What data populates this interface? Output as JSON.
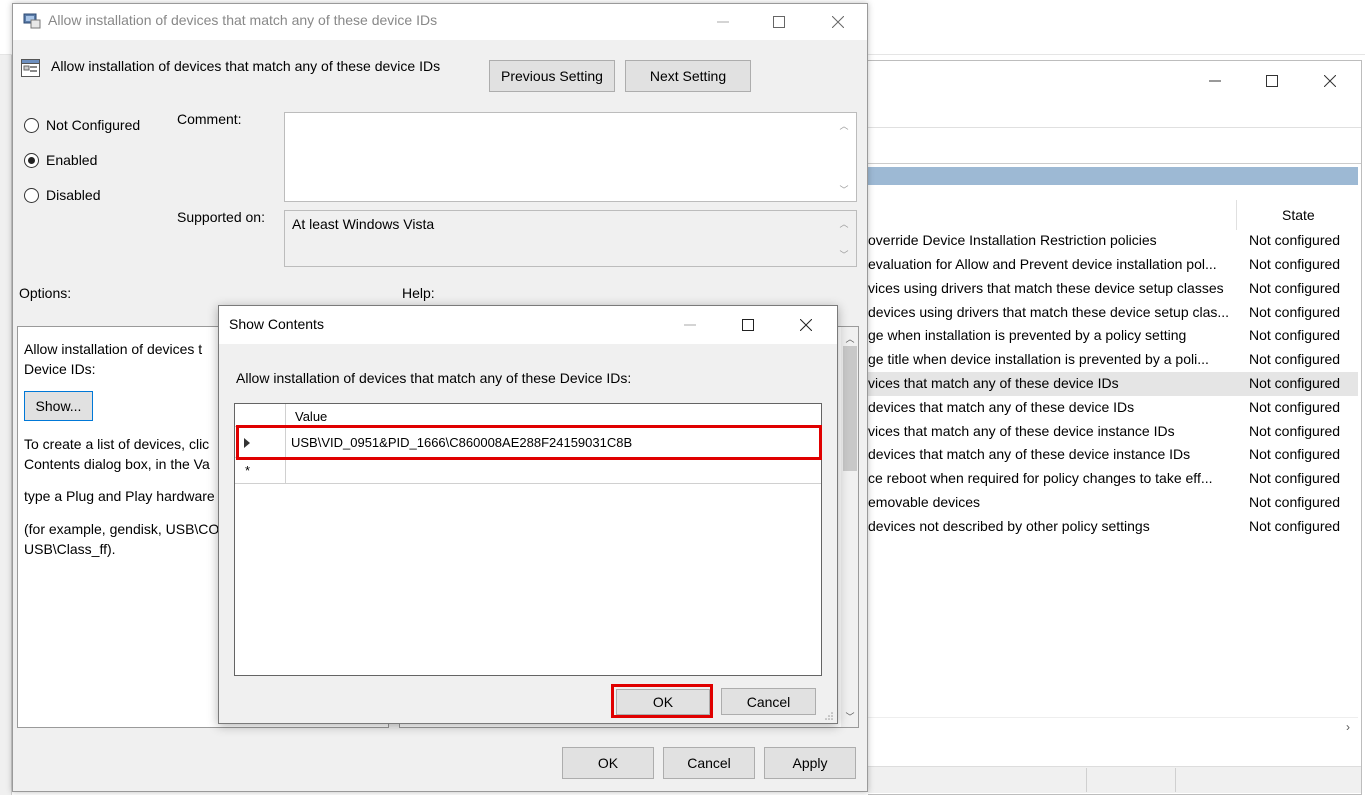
{
  "bg_window": {
    "state_header": "State",
    "rows": [
      {
        "name": "override Device Installation Restriction policies",
        "state": "Not configured"
      },
      {
        "name": "evaluation for Allow and Prevent device installation pol...",
        "state": "Not configured"
      },
      {
        "name": "vices using drivers that match these device setup classes",
        "state": "Not configured"
      },
      {
        "name": "devices using drivers that match these device setup clas...",
        "state": "Not configured"
      },
      {
        "name": "ge when installation is prevented by a policy setting",
        "state": "Not configured"
      },
      {
        "name": "ge title when device installation is prevented by a poli...",
        "state": "Not configured"
      },
      {
        "name": "vices that match any of these device IDs",
        "state": "Not configured"
      },
      {
        "name": "devices that match any of these device IDs",
        "state": "Not configured"
      },
      {
        "name": "vices that match any of these device instance IDs",
        "state": "Not configured"
      },
      {
        "name": "devices that match any of these device instance IDs",
        "state": "Not configured"
      },
      {
        "name": "ce reboot when required for policy changes to take eff...",
        "state": "Not configured"
      },
      {
        "name": "emovable devices",
        "state": "Not configured"
      },
      {
        "name": "devices not described by other policy settings",
        "state": "Not configured"
      }
    ]
  },
  "policy_window": {
    "title": "Allow installation of devices that match any of these device IDs",
    "header_title": "Allow installation of devices that match any of these device IDs",
    "previous_label": "Previous Setting",
    "next_label": "Next Setting",
    "radio_not_configured": "Not Configured",
    "radio_enabled": "Enabled",
    "radio_disabled": "Disabled",
    "comment_label": "Comment:",
    "supported_label": "Supported on:",
    "supported_value": "At least Windows Vista",
    "options_label": "Options:",
    "help_label": "Help:",
    "options_text_1": "Allow installation of devices t",
    "options_text_2": "Device IDs:",
    "show_label": "Show...",
    "help_text_1": "To create a list of devices, clic",
    "help_text_2": "Contents dialog box, in the Va",
    "help_text_3": "type a Plug and Play hardware",
    "help_text_4": "(for example, gendisk, USB\\CO",
    "help_text_5": "USB\\Class_ff).",
    "ok_label": "OK",
    "cancel_label": "Cancel",
    "apply_label": "Apply"
  },
  "show_contents": {
    "title": "Show Contents",
    "prompt": "Allow installation of devices that match any of these Device IDs:",
    "column_header": "Value",
    "rows": [
      "USB\\VID_0951&PID_1666\\C860008AE288F24159031C8B"
    ],
    "new_row_marker": "*",
    "ok_label": "OK",
    "cancel_label": "Cancel"
  },
  "colors": {
    "highlight": "#e00000",
    "group_bar": "#9db9d4",
    "dialog_bg": "#f0f0f0"
  }
}
